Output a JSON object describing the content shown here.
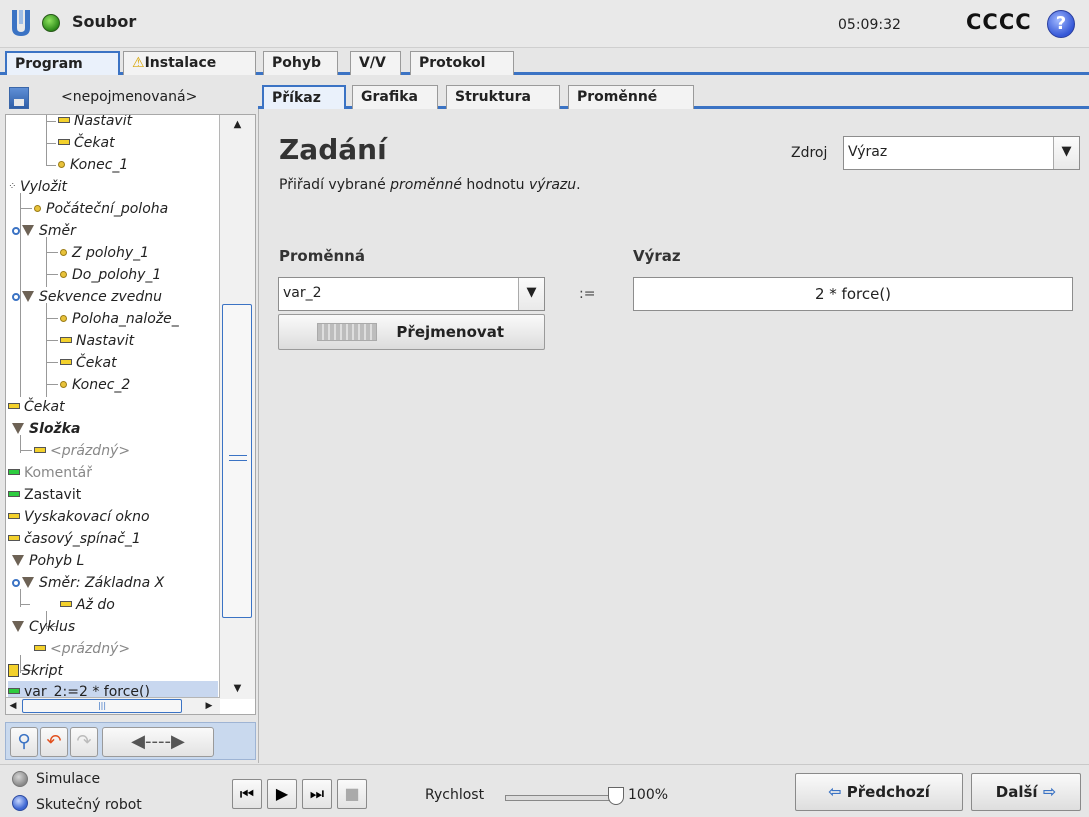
{
  "header": {
    "app_name": "Soubor",
    "clock": "05:09:32",
    "user": "CCCC",
    "help_glyph": "?"
  },
  "main_tabs": [
    {
      "label": "Program",
      "active": true
    },
    {
      "label": "Instalace",
      "warning": true
    },
    {
      "label": "Pohyb"
    },
    {
      "label": "V/V"
    },
    {
      "label": "Protokol"
    }
  ],
  "program": {
    "file_name": "<nepojmenovaná>"
  },
  "tree": [
    {
      "label": "Nastavit",
      "icon": "set-icon"
    },
    {
      "label": "Čekat",
      "icon": "wait-icon"
    },
    {
      "label": "Konec_1",
      "icon": "waypoint-icon"
    },
    {
      "label": "Vyložit",
      "icon": "pattern-icon"
    },
    {
      "label": "Počáteční_poloha",
      "icon": "waypoint-icon"
    },
    {
      "label": "Směr",
      "icon": "direction-icon"
    },
    {
      "label": "Z polohy_1",
      "icon": "waypoint-icon"
    },
    {
      "label": "Do_polohy_1",
      "icon": "waypoint-icon"
    },
    {
      "label": "Sekvence zvednu",
      "icon": "folder-icon"
    },
    {
      "label": "Poloha_nalože_",
      "icon": "waypoint-icon"
    },
    {
      "label": "Nastavit",
      "icon": "set-icon"
    },
    {
      "label": "Čekat",
      "icon": "wait-icon"
    },
    {
      "label": "Konec_2",
      "icon": "waypoint-icon"
    },
    {
      "label": "Čekat",
      "icon": "wait-icon"
    },
    {
      "label": "Složka",
      "icon": "folder-icon"
    },
    {
      "label": "<prázdný>",
      "icon": "empty-icon"
    },
    {
      "label": "Komentář",
      "icon": "comment-icon"
    },
    {
      "label": "Zastavit",
      "icon": "stop-icon"
    },
    {
      "label": "Vyskakovací okno",
      "icon": "popup-icon"
    },
    {
      "label": "časový_spínač_1",
      "icon": "timer-icon"
    },
    {
      "label": "Pohyb L",
      "icon": "move-icon"
    },
    {
      "label": "Směr: Základna X",
      "icon": "direction-icon"
    },
    {
      "label": "Až do",
      "icon": "until-icon"
    },
    {
      "label": "Cyklus",
      "icon": "loop-icon"
    },
    {
      "label": "<prázdný>",
      "icon": "empty-icon"
    },
    {
      "label": "Skript",
      "icon": "script-icon"
    },
    {
      "label": "var_2:=2 * force()",
      "icon": "assignment-icon"
    }
  ],
  "sub_tabs": [
    {
      "label": "Příkaz",
      "active": true
    },
    {
      "label": "Grafika"
    },
    {
      "label": "Struktura"
    },
    {
      "label": "Proměnné"
    }
  ],
  "assignment": {
    "title": "Zadání",
    "desc_1": "Přiřadí vybrané ",
    "desc_2": "proměnné",
    "desc_3": " hodnotu ",
    "desc_4": "výrazu",
    "desc_5": ".",
    "source_label": "Zdroj",
    "source_value": "Výraz",
    "variable_label": "Proměnná",
    "variable_value": "var_2",
    "assign_op": ":=",
    "expression_label": "Výraz",
    "expression_value": "2 * force()",
    "rename_label": "Přejmenovat"
  },
  "bottom": {
    "simulation_label": "Simulace",
    "real_robot_label": "Skutečný robot",
    "speed_label": "Rychlost",
    "speed_value": "100%",
    "speed_fraction": 1.0,
    "prev_label": "Předchozí",
    "next_label": "Další"
  },
  "colors": {
    "accent": "#3b73c4",
    "status_ok": "#2d8a1a",
    "warning": "#d7a400"
  }
}
